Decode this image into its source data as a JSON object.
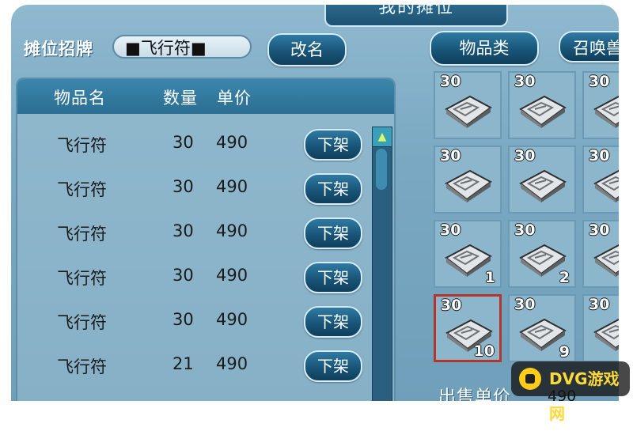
{
  "window": {
    "title": "我的摊位"
  },
  "stall": {
    "sign_label": "摊位招牌",
    "sign_value": "■飞行符■",
    "rename_label": "改名"
  },
  "tabs": [
    {
      "label": "物品类"
    },
    {
      "label": "召唤兽"
    }
  ],
  "list": {
    "headers": {
      "name": "物品名",
      "qty": "数量",
      "price": "单价"
    },
    "rows": [
      {
        "name": "飞行符",
        "qty": "30",
        "price": "490",
        "action": "下架"
      },
      {
        "name": "飞行符",
        "qty": "30",
        "price": "490",
        "action": "下架"
      },
      {
        "name": "飞行符",
        "qty": "30",
        "price": "490",
        "action": "下架"
      },
      {
        "name": "飞行符",
        "qty": "30",
        "price": "490",
        "action": "下架"
      },
      {
        "name": "飞行符",
        "qty": "30",
        "price": "490",
        "action": "下架"
      },
      {
        "name": "飞行符",
        "qty": "21",
        "price": "490",
        "action": "下架"
      }
    ]
  },
  "inventory": {
    "slots": [
      {
        "qty": "30",
        "badge": ""
      },
      {
        "qty": "30",
        "badge": ""
      },
      {
        "qty": "30",
        "badge": ""
      },
      {
        "qty": "30",
        "badge": ""
      },
      {
        "qty": "30",
        "badge": ""
      },
      {
        "qty": "30",
        "badge": ""
      },
      {
        "qty": "30",
        "badge": "1"
      },
      {
        "qty": "30",
        "badge": "2"
      },
      {
        "qty": "30",
        "badge": ""
      },
      {
        "qty": "30",
        "badge": "10",
        "selected": true
      },
      {
        "qty": "30",
        "badge": "9"
      },
      {
        "qty": "30",
        "badge": ""
      }
    ]
  },
  "sale": {
    "price_label": "出售单价",
    "price_value": "490"
  },
  "watermark": {
    "text": "DVG游戏网"
  },
  "colors": {
    "accent": "#1d5a7e",
    "panel": "#8bb6cc",
    "selection": "#b3352c"
  },
  "icons": {
    "scroll_up": "triangle-up-icon",
    "item": "flying-talisman-icon",
    "watermark": "gamepad-logo-icon"
  }
}
